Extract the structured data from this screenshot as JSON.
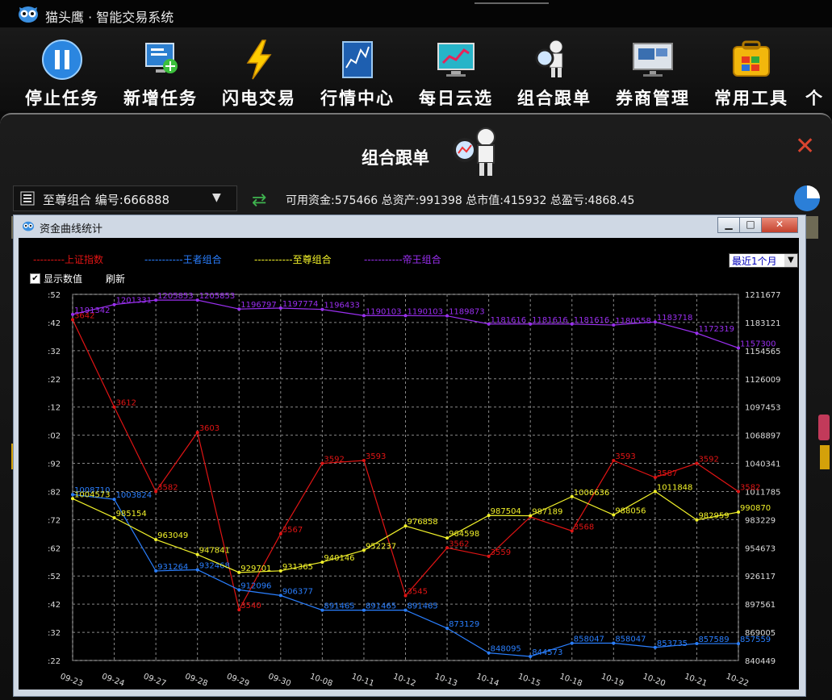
{
  "app": {
    "title": "猫头鹰 · 智能交易系统"
  },
  "toolbar": {
    "items": [
      {
        "label": "停止任务",
        "icon": "pause-icon"
      },
      {
        "label": "新增任务",
        "icon": "add-task-icon"
      },
      {
        "label": "闪电交易",
        "icon": "lightning-icon"
      },
      {
        "label": "行情中心",
        "icon": "market-chart-icon"
      },
      {
        "label": "每日云选",
        "icon": "monitor-trend-icon"
      },
      {
        "label": "组合跟单",
        "icon": "magnifier-robot-icon"
      },
      {
        "label": "券商管理",
        "icon": "broker-screen-icon"
      },
      {
        "label": "常用工具",
        "icon": "toolbox-icon"
      },
      {
        "label": "个",
        "icon": ""
      }
    ]
  },
  "panel": {
    "title": "组合跟单",
    "combo": "至尊组合 编号:666888",
    "stats": "可用资金:575466 总资产:991398 总市值:415932 总盈亏:4868.45"
  },
  "chart_window": {
    "title": "资金曲线统计",
    "legend": [
      {
        "name": "上证指数",
        "color": "#e01414"
      },
      {
        "name": "王者组合",
        "color": "#2a7fff"
      },
      {
        "name": "至尊组合",
        "color": "#f2f22a"
      },
      {
        "name": "帝王组合",
        "color": "#9a2ff0"
      }
    ],
    "period": "最近1个月",
    "show_values_label": "显示数值",
    "refresh_label": "刷新"
  },
  "chart_data": {
    "type": "line",
    "categories": [
      "09-23",
      "09-24",
      "09-27",
      "09-28",
      "09-29",
      "09-30",
      "10-08",
      "10-11",
      "10-12",
      "10-13",
      "10-14",
      "10-15",
      "10-18",
      "10-19",
      "10-20",
      "10-21",
      "10-22"
    ],
    "left_axis_ticks": [
      ":52",
      ":42",
      ":32",
      ":22",
      ":12",
      ":02",
      ":92",
      ":82",
      ":72",
      ":62",
      ":52",
      ":42",
      ":32",
      ":22"
    ],
    "right_axis_ticks": [
      "1211677",
      "1183121",
      "1154565",
      "1126009",
      "1097453",
      "1068897",
      "1040341",
      "1011785",
      "983229",
      "954673",
      "926117",
      "897561",
      "869005",
      "840449"
    ],
    "right_ylim": [
      840449,
      1211677
    ],
    "left_ylim": [
      3522,
      3652
    ],
    "grid": true,
    "series": [
      {
        "name": "上证指数",
        "color": "#e01414",
        "axis": "left",
        "values": [
          3643,
          3612,
          3582,
          3603,
          3540,
          3567,
          3592,
          3593,
          3545,
          3562,
          3559,
          3573,
          3568,
          3593,
          3587,
          3592,
          3582
        ],
        "labels": [
          "3642",
          "3612",
          "3582",
          "3603",
          "3540",
          "3567",
          "3592",
          "3593",
          "3545",
          "3562",
          "3559",
          "",
          "3568",
          "3593",
          "3587",
          "3592",
          "3582"
        ]
      },
      {
        "name": "王者组合",
        "color": "#2a7fff",
        "axis": "right",
        "values": [
          1008710,
          1003824,
          931264,
          932468,
          912096,
          906377,
          891465,
          891465,
          891465,
          873129,
          848095,
          844573,
          858047,
          858047,
          853735,
          857589,
          857559
        ],
        "labels": [
          "1008710",
          "1003824",
          "931264",
          "932468",
          "912096",
          "906377",
          "891465",
          "891465",
          "891465",
          "873129",
          "848095",
          "844573",
          "858047",
          "858047",
          "853735",
          "857589",
          "857559"
        ]
      },
      {
        "name": "至尊组合",
        "color": "#f2f22a",
        "axis": "right",
        "values": [
          1004573,
          985154,
          963049,
          947841,
          929701,
          931365,
          940146,
          952237,
          976858,
          964598,
          987504,
          987189,
          1006636,
          988056,
          1011848,
          982959,
          990870
        ],
        "labels": [
          "1004573",
          "985154",
          "963049",
          "947841",
          "929701",
          "931365",
          "940146",
          "952237",
          "976858",
          "964598",
          "987504",
          "987189",
          "1006636",
          "988056",
          "1011848",
          "982959",
          "990870"
        ]
      },
      {
        "name": "帝王组合",
        "color": "#9a2ff0",
        "axis": "right",
        "values": [
          1191342,
          1201331,
          1205853,
          1205853,
          1196797,
          1197774,
          1196433,
          1190103,
          1190103,
          1189873,
          1181616,
          1181616,
          1181616,
          1180558,
          1183718,
          1172319,
          1157300
        ],
        "labels": [
          "1191342",
          "1201331",
          "1205853",
          "1205853",
          "1196797",
          "1197774",
          "1196433",
          "1190103",
          "1190103",
          "1189873",
          "1181616",
          "1181616",
          "1181616",
          "1180558",
          "1183718",
          "1172319",
          "1157300"
        ]
      }
    ]
  }
}
